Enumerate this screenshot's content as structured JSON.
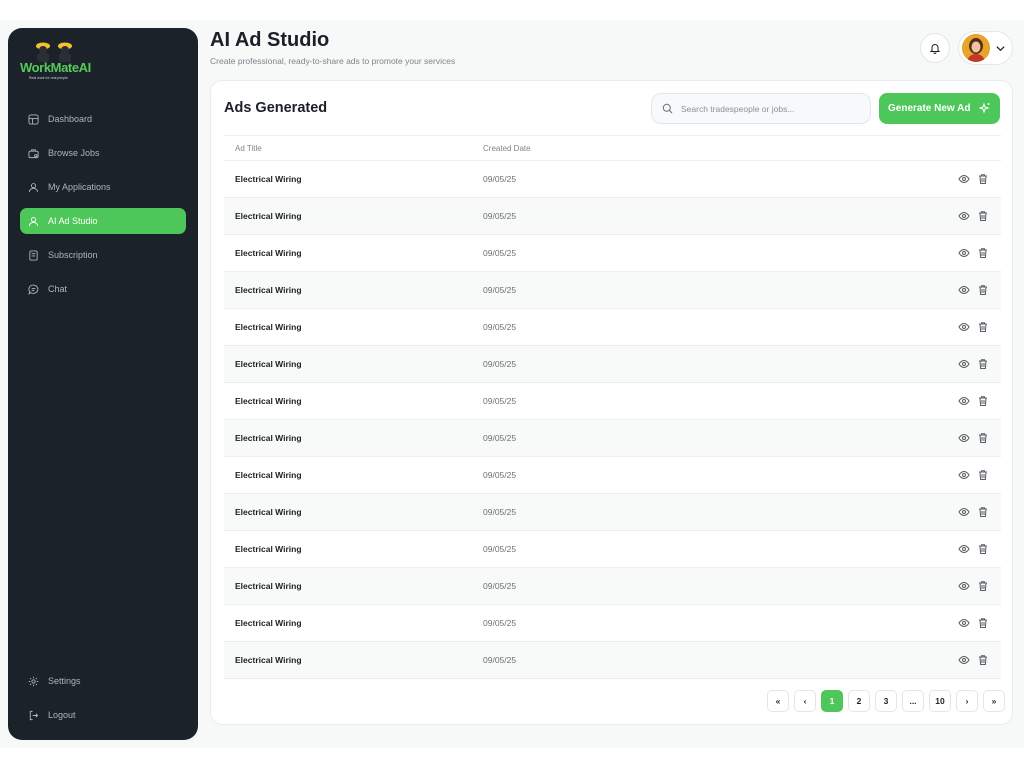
{
  "brand": {
    "logo_text": "WorkMateAI",
    "tagline": "Real work for real people"
  },
  "sidebar": {
    "items": [
      {
        "label": "Dashboard",
        "icon": "dashboard-icon"
      },
      {
        "label": "Browse Jobs",
        "icon": "briefcase-icon"
      },
      {
        "label": "My Applications",
        "icon": "user-icon"
      },
      {
        "label": "AI Ad Studio",
        "icon": "user-icon",
        "active": true
      },
      {
        "label": "Subscription",
        "icon": "document-icon"
      },
      {
        "label": "Chat",
        "icon": "chat-icon"
      }
    ],
    "bottom_items": [
      {
        "label": "Settings",
        "icon": "gear-icon"
      },
      {
        "label": "Logout",
        "icon": "logout-icon"
      }
    ]
  },
  "header": {
    "title": "AI Ad Studio",
    "subtitle": "Create professional, ready-to-share ads to promote your services"
  },
  "card": {
    "title": "Ads Generated",
    "search_placeholder": "Search tradespeople or jobs...",
    "generate_label": "Generate New Ad"
  },
  "table": {
    "columns": [
      "Ad Title",
      "Created Date"
    ],
    "rows": [
      {
        "title": "Electrical Wiring",
        "date": "09/05/25"
      },
      {
        "title": "Electrical Wiring",
        "date": "09/05/25"
      },
      {
        "title": "Electrical Wiring",
        "date": "09/05/25"
      },
      {
        "title": "Electrical Wiring",
        "date": "09/05/25"
      },
      {
        "title": "Electrical Wiring",
        "date": "09/05/25"
      },
      {
        "title": "Electrical Wiring",
        "date": "09/05/25"
      },
      {
        "title": "Electrical Wiring",
        "date": "09/05/25"
      },
      {
        "title": "Electrical Wiring",
        "date": "09/05/25"
      },
      {
        "title": "Electrical Wiring",
        "date": "09/05/25"
      },
      {
        "title": "Electrical Wiring",
        "date": "09/05/25"
      },
      {
        "title": "Electrical Wiring",
        "date": "09/05/25"
      },
      {
        "title": "Electrical Wiring",
        "date": "09/05/25"
      },
      {
        "title": "Electrical Wiring",
        "date": "09/05/25"
      },
      {
        "title": "Electrical Wiring",
        "date": "09/05/25"
      }
    ]
  },
  "pagination": {
    "first": "«",
    "prev": "‹",
    "pages": [
      "1",
      "2",
      "3",
      "...",
      "10"
    ],
    "current": "1",
    "next": "›",
    "last": "»"
  },
  "colors": {
    "accent": "#4dc75a",
    "sidebar_bg": "#1c2229"
  }
}
